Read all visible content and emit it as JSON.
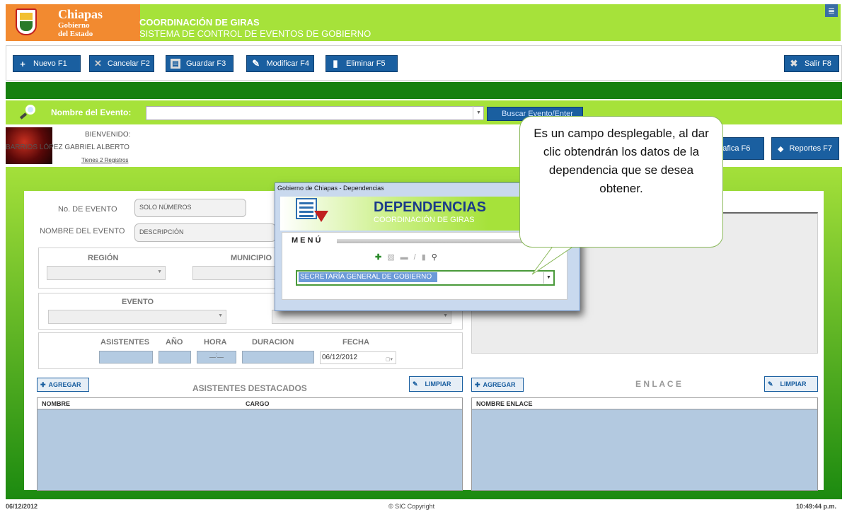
{
  "header": {
    "logo_line1": "Chiapas",
    "logo_line2": "Gobierno",
    "logo_line3": "del Estado",
    "title": "COORDINACIÓN DE GIRAS",
    "subtitle": "SISTEMA DE CONTROL DE EVENTOS DE GOBIERNO"
  },
  "toolbar": {
    "nuevo": "Nuevo F1",
    "cancelar": "Cancelar F2",
    "guardar": "Guardar F3",
    "modificar": "Modificar F4",
    "eliminar": "Eliminar F5",
    "salir": "Salir F8"
  },
  "search": {
    "label": "Nombre del Evento:",
    "value": "",
    "button": "Buscar Evento/Enter"
  },
  "user": {
    "welcome": "BIENVENIDO:",
    "name": "BARRIOS LÓPEZ GABRIEL ALBERTO",
    "records": "Tienes 2 Registros"
  },
  "right_buttons": {
    "grafica": "Grafica F6",
    "reportes": "Reportes F7"
  },
  "form": {
    "no_evento_label": "No. DE EVENTO",
    "no_evento_placeholder": "SOLO NÚMEROS",
    "nombre_evento_label": "NOMBRE DEL EVENTO",
    "nombre_evento_placeholder": "DESCRIPCIÓN",
    "region_label": "REGIÓN",
    "municipio_label": "MUNICIPIO",
    "evento_label": "EVENTO",
    "asistentes_label": "ASISTENTES",
    "anio_label": "AÑO",
    "hora_label": "HORA",
    "hora_value": "__:__",
    "duracion_label": "DURACION",
    "fecha_label": "FECHA",
    "fecha_value": "06/12/2012"
  },
  "asistentes": {
    "agregar": "AGREGAR",
    "title": "ASISTENTES DESTACADOS",
    "limpiar": "LIMPIAR",
    "columns": [
      "NOMBRE",
      "CARGO"
    ]
  },
  "enlace": {
    "agregar": "AGREGAR",
    "title": "E N L A C E",
    "limpiar": "LIMPIAR",
    "columns": [
      "NOMBRE ENLACE"
    ]
  },
  "modal": {
    "window_title": "Gobierno de Chiapas - Dependencias",
    "heading": "DEPENDENCIAS",
    "subheading": "COORDINACIÓN DE GIRAS",
    "menu_label": "MENÚ",
    "selected": "SECRETARÍA GENERAL DE GOBIERNO"
  },
  "callout": {
    "text": "Es un campo desplegable, al dar clic obtendrán los datos de la dependencia que se desea obtener."
  },
  "footer": {
    "date": "06/12/2012",
    "copyright": "© SIC Copyright",
    "time": "10:49:44 p.m."
  },
  "colors": {
    "header_green": "#a6e23a",
    "dark_green": "#16800e",
    "button_blue": "#1a5fa0",
    "logo_orange": "#f28a30"
  }
}
